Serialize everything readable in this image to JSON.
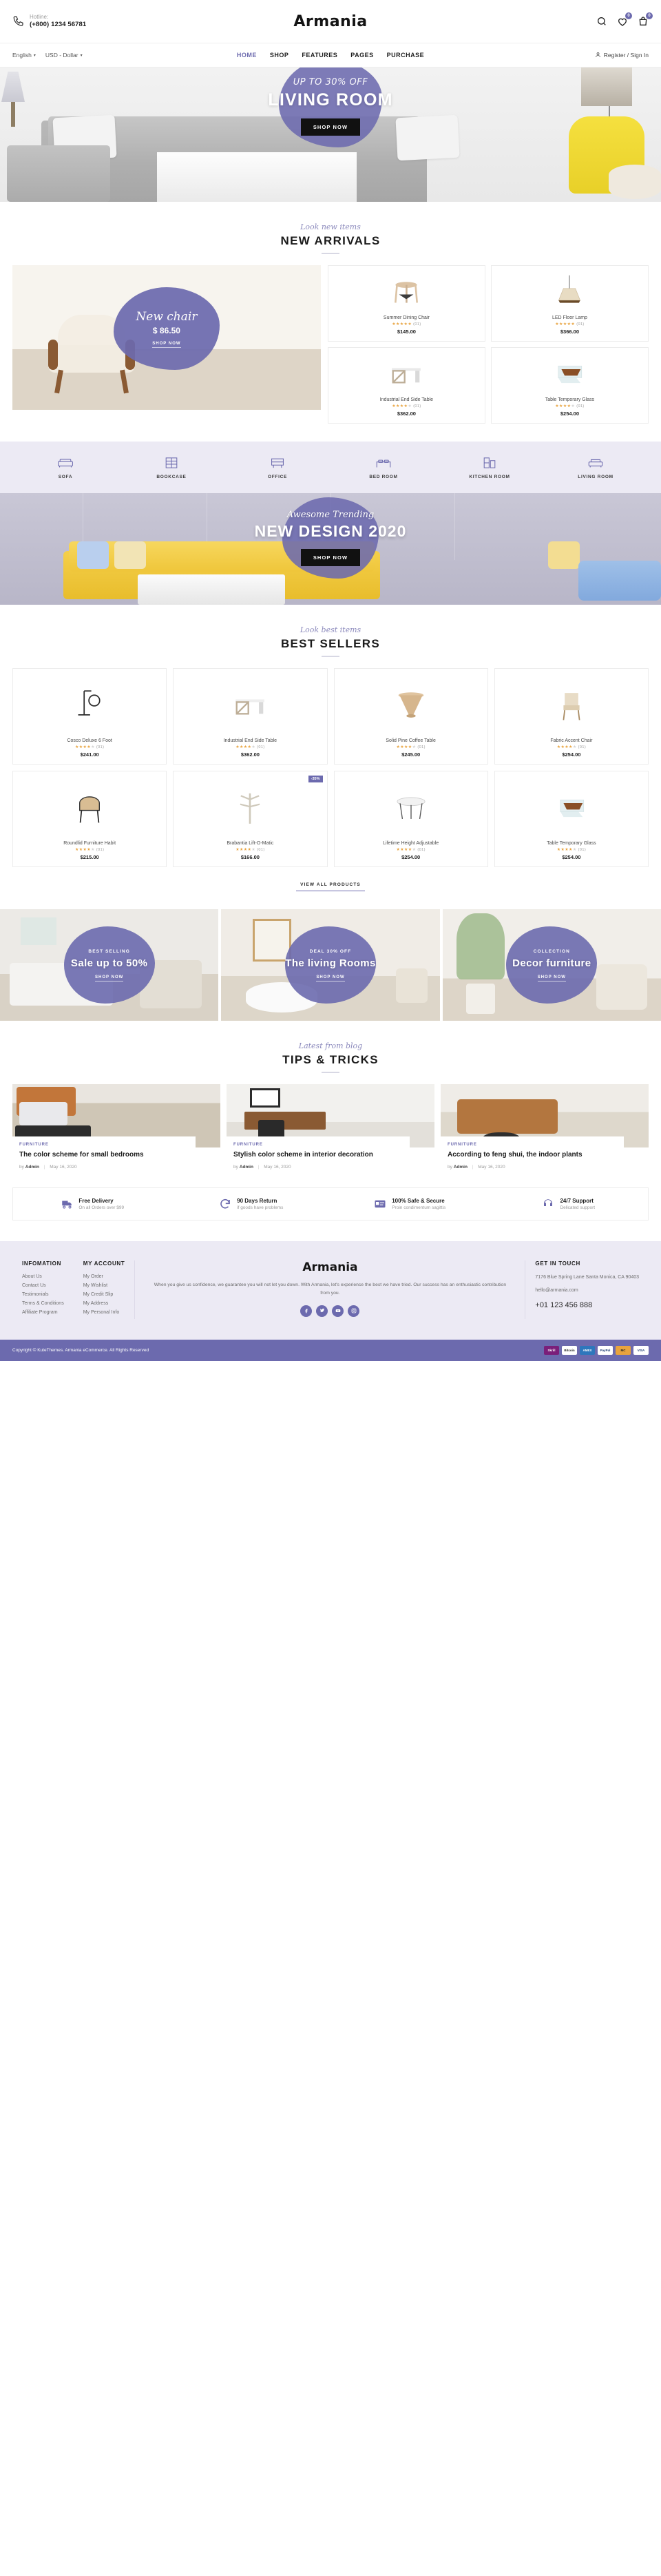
{
  "header": {
    "hotline_label": "Hotline:",
    "hotline_number": "(+800) 1234 56781",
    "brand": "Armania",
    "language": "English",
    "currency": "USD - Dollar",
    "wishlist_count": "0",
    "cart_count": "0",
    "account": "Register / Sign In",
    "nav": [
      {
        "label": "HOME",
        "active": true
      },
      {
        "label": "SHOP",
        "active": false
      },
      {
        "label": "FEATURES",
        "active": false
      },
      {
        "label": "PAGES",
        "active": false
      },
      {
        "label": "PURCHASE",
        "active": false
      }
    ]
  },
  "hero": {
    "subtitle": "UP TO 30% OFF",
    "title": "LIVING ROOM",
    "button": "SHOP NOW"
  },
  "new_arrivals": {
    "script": "Look new items",
    "title": "NEW ARRIVALS",
    "feature": {
      "line1": "New chair",
      "price": "$ 86.50",
      "button": "SHOP NOW"
    },
    "products": [
      {
        "name": "Summer Dining Chair",
        "stars": 5,
        "count": "(01)",
        "price": "$145.00"
      },
      {
        "name": "LED Floor Lamp",
        "stars": 5,
        "count": "(01)",
        "price": "$366.00"
      },
      {
        "name": "Industrial End Side Table",
        "stars": 4,
        "count": "(01)",
        "price": "$362.00"
      },
      {
        "name": "Table Temporary Glass",
        "stars": 4,
        "count": "(01)",
        "price": "$254.00"
      }
    ]
  },
  "categories": [
    {
      "label": "SOFA",
      "icon": "sofa-icon"
    },
    {
      "label": "BOOKCASE",
      "icon": "bookcase-icon"
    },
    {
      "label": "OFFICE",
      "icon": "office-icon"
    },
    {
      "label": "BED ROOM",
      "icon": "bed-icon"
    },
    {
      "label": "KITCHEN ROOM",
      "icon": "kitchen-icon"
    },
    {
      "label": "LIVING ROOM",
      "icon": "living-room-icon"
    }
  ],
  "trending": {
    "subtitle": "Awesome Trending",
    "title": "NEW DESIGN 2020",
    "button": "SHOP NOW"
  },
  "best_sellers": {
    "script": "Look best items",
    "title": "BEST SELLERS",
    "view_all": "VIEW ALL PRODUCTS",
    "products": [
      {
        "name": "Cosco Deluxe 6 Foot",
        "stars": 4,
        "count": "(01)",
        "price": "$241.00",
        "tag": ""
      },
      {
        "name": "Industrial End Side Table",
        "stars": 4,
        "count": "(01)",
        "price": "$362.00",
        "tag": ""
      },
      {
        "name": "Solid Pine Coffee Table",
        "stars": 4,
        "count": "(01)",
        "price": "$245.00",
        "tag": ""
      },
      {
        "name": "Fabric Accent Chair",
        "stars": 4,
        "count": "(01)",
        "price": "$254.00",
        "tag": ""
      },
      {
        "name": "Roundlid Furniture Habit",
        "stars": 4,
        "count": "(01)",
        "price": "$215.00",
        "tag": ""
      },
      {
        "name": "Brabantia Lift-O-Matic",
        "stars": 4,
        "count": "(01)",
        "price": "$166.00",
        "tag": "-35%"
      },
      {
        "name": "Lifetime Height Adjustable",
        "stars": 4,
        "count": "(01)",
        "price": "$254.00",
        "tag": ""
      },
      {
        "name": "Table Temporary Glass",
        "stars": 4,
        "count": "(01)",
        "price": "$254.00",
        "tag": ""
      }
    ]
  },
  "promos": [
    {
      "kicker": "BEST SELLING",
      "title": "Sale up to 50%",
      "button": "SHOP NOW"
    },
    {
      "kicker": "DEAL 30% OFF",
      "title": "The living Rooms",
      "button": "SHOP NOW"
    },
    {
      "kicker": "COLLECTION",
      "title": "Decor furniture",
      "button": "SHOP NOW"
    }
  ],
  "blog": {
    "script": "Latest from blog",
    "title": "TIPS & TRICKS",
    "posts": [
      {
        "category": "FURNITURE",
        "title": "The color scheme for small bedrooms",
        "author": "Admin",
        "date": "May 16, 2020"
      },
      {
        "category": "FURNITURE",
        "title": "Stylish color scheme in interior decoration",
        "author": "Admin",
        "date": "May 16, 2020"
      },
      {
        "category": "FURNITURE",
        "title": "According to feng shui, the indoor plants",
        "author": "Admin",
        "date": "May 16, 2020"
      }
    ],
    "by_label": "by",
    "separator": "|"
  },
  "features": [
    {
      "icon": "truck-icon",
      "title": "Free Delivery",
      "sub": "On all Orders over $99"
    },
    {
      "icon": "refresh-icon",
      "title": "90 Days Return",
      "sub": "if goods have problems"
    },
    {
      "icon": "card-icon",
      "title": "100% Safe & Secure",
      "sub": "Proin condimentum sagittis"
    },
    {
      "icon": "support-icon",
      "title": "24/7 Support",
      "sub": "Delicated support"
    }
  ],
  "footer": {
    "information": {
      "heading": "INFOMATION",
      "links": [
        "About Us",
        "Contact Us",
        "Testimonials",
        "Terms & Conditions",
        "Affiliate Program"
      ]
    },
    "account": {
      "heading": "MY ACCOUNT",
      "links": [
        "My Order",
        "My Wishlist",
        "My Credit Slip",
        "My Address",
        "My Personal Info"
      ]
    },
    "brand": "Armania",
    "description": "When you give us confidence, we guarantee you will not let you down. With Armania, let's experience the best we have tried. Our success has an enthusiastic contribution from you.",
    "socials": [
      "facebook-icon",
      "twitter-icon",
      "youtube-icon",
      "instagram-icon"
    ],
    "touch": {
      "heading": "GET IN TOUCH",
      "address": "7176 Blue Spring Lane Santa Monica, CA 90403",
      "email": "hello@armania.com",
      "phone": "+01 123 456 888"
    },
    "copyright": "Copyright © KuteThemes. Armania eCommerce. All Rights Reserved",
    "payments": [
      "Skrill",
      "Bitcoin",
      "AMEX",
      "PayPal",
      "MC",
      "VISA"
    ]
  },
  "colors": {
    "accent": "#6c6aae",
    "lavender_bg": "#eceaf4",
    "star": "#e8a33d"
  }
}
